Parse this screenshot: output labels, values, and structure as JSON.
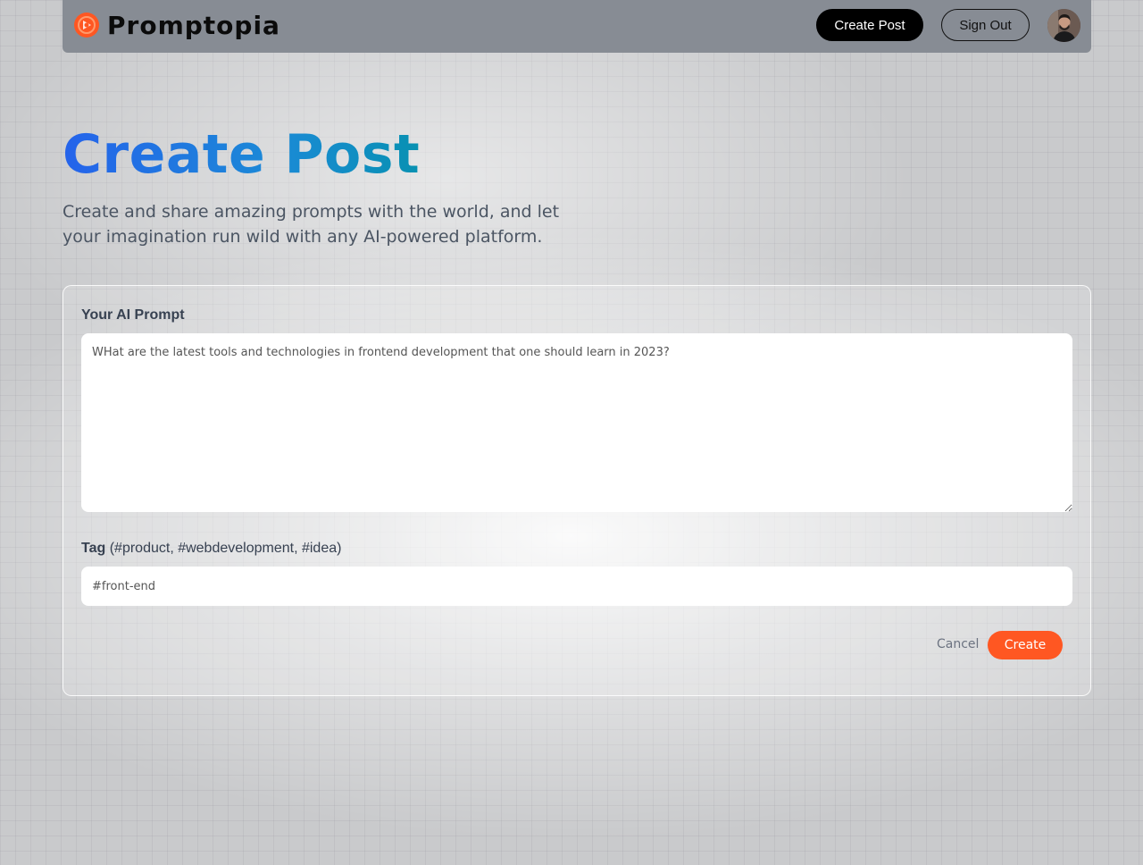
{
  "nav": {
    "logo_text": "Promptopia",
    "create_post_label": "Create Post",
    "sign_out_label": "Sign Out",
    "avatar_icon": "user-avatar"
  },
  "header": {
    "title": "Create Post",
    "subtitle": "Create and share amazing prompts with the world, and let your imagination run wild with any AI-powered platform."
  },
  "form": {
    "prompt_label": "Your AI Prompt",
    "prompt_value": "WHat are the latest tools and technologies in frontend development that one should learn in 2023?",
    "tag_label": "Tag",
    "tag_hint": "(#product, #webdevelopment, #idea)",
    "tag_value": "#front-end",
    "cancel_label": "Cancel",
    "submit_label": "Create"
  },
  "colors": {
    "accent": "#ff5722",
    "title_gradient_start": "#2563eb",
    "title_gradient_end": "#0891b2"
  }
}
